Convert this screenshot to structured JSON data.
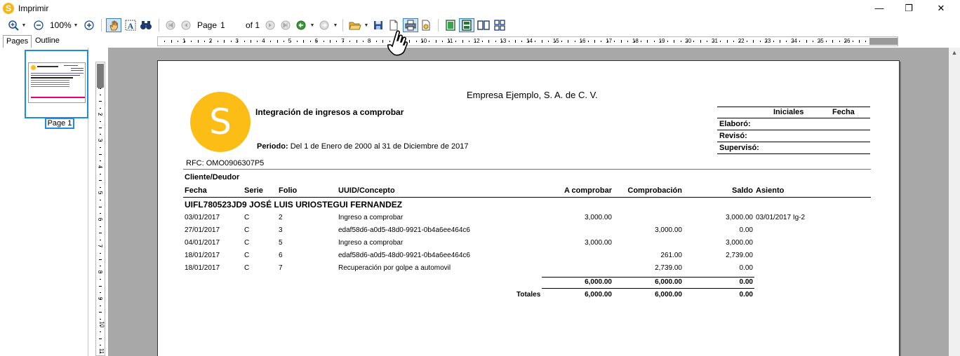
{
  "window": {
    "title": "Imprimir",
    "app_icon_letter": "S",
    "controls": {
      "minimize": "—",
      "maximize": "❐",
      "close": "✕"
    }
  },
  "toolbar": {
    "zoom_level": "100%",
    "page_label": "Page",
    "page_number": "1",
    "page_of": "of 1"
  },
  "pane_tabs": [
    "Pages",
    "Outline"
  ],
  "thumbnail": {
    "label": "Page 1"
  },
  "ruler": {
    "horizontal": [
      "1",
      "2",
      "3",
      "4",
      "5",
      "6",
      "7",
      "8",
      "9",
      "10",
      "11",
      "12",
      "13",
      "14",
      "15",
      "16",
      "17",
      "18",
      "19",
      "20",
      "21",
      "22",
      "23",
      "24",
      "25",
      "26",
      "27"
    ],
    "vertical": [
      "1",
      "2",
      "3",
      "4",
      "5",
      "6",
      "7",
      "8",
      "9",
      "10",
      "11"
    ]
  },
  "report": {
    "company": "Empresa Ejemplo, S. A. de C. V.",
    "title": "Integración de ingresos a comprobar",
    "logo_letter": "S",
    "period_label": "Periodo:",
    "period_value": "Del 1 de Enero de 2000 al 31 de Diciembre de 2017",
    "rfc": "RFC: OMO0906307P5",
    "signatures": {
      "col_initials": "Iniciales",
      "col_date": "Fecha",
      "rows": [
        "Elaboró:",
        "Revisó:",
        "Supervisó:"
      ]
    },
    "group_label": "Cliente/Deudor",
    "columns": {
      "fecha": "Fecha",
      "serie": "Serie",
      "folio": "Folio",
      "uuid": "UUID/Concepto",
      "a_comprobar": "A comprobar",
      "comprobacion": "Comprobación",
      "saldo": "Saldo",
      "asiento": "Asiento"
    },
    "client": "UIFL780523JD9 JOSÉ LUIS URIOSTEGUI FERNANDEZ",
    "rows": [
      {
        "fecha": "03/01/2017",
        "serie": "C",
        "folio": "2",
        "concepto": "Ingreso a comprobar",
        "a_comprobar": "3,000.00",
        "comprobacion": "",
        "saldo": "3,000.00",
        "asiento": "03/01/2017 Ig-2"
      },
      {
        "fecha": "27/01/2017",
        "serie": "C",
        "folio": "3",
        "concepto": "edaf58d6-a0d5-48d0-9921-0b4a6ee464c6",
        "a_comprobar": "",
        "comprobacion": "3,000.00",
        "saldo": "0.00",
        "asiento": ""
      },
      {
        "fecha": "04/01/2017",
        "serie": "C",
        "folio": "5",
        "concepto": "Ingreso a comprobar",
        "a_comprobar": "3,000.00",
        "comprobacion": "",
        "saldo": "3,000.00",
        "asiento": ""
      },
      {
        "fecha": "18/01/2017",
        "serie": "C",
        "folio": "6",
        "concepto": "edaf58d6-a0d5-48d0-9921-0b4a6ee464c6",
        "a_comprobar": "",
        "comprobacion": "261.00",
        "saldo": "2,739.00",
        "asiento": ""
      },
      {
        "fecha": "18/01/2017",
        "serie": "C",
        "folio": "7",
        "concepto": "Recuperación por golpe a automovil",
        "a_comprobar": "",
        "comprobacion": "2,739.00",
        "saldo": "0.00",
        "asiento": ""
      }
    ],
    "subtotal": {
      "a_comprobar": "6,000.00",
      "comprobacion": "6,000.00",
      "saldo": "0.00"
    },
    "totals": {
      "label": "Totales",
      "a_comprobar": "6,000.00",
      "comprobacion": "6,000.00",
      "saldo": "0.00"
    }
  },
  "colors": {
    "accent": "#1d8de0",
    "logo": "#fbbd16",
    "workspace": "#a8a8a8"
  }
}
